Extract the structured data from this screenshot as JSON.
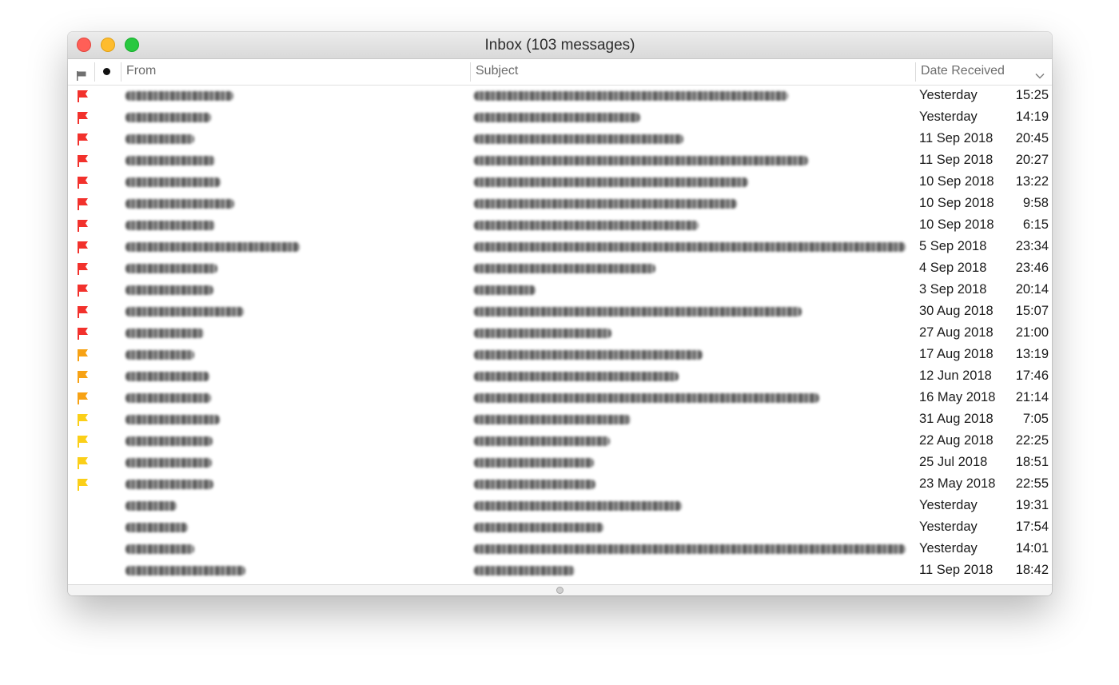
{
  "window": {
    "title": "Inbox (103 messages)"
  },
  "columns": {
    "from": "From",
    "subject": "Subject",
    "date": "Date Received"
  },
  "flag_colors": {
    "red": "#f2312c",
    "orange": "#f7a214",
    "yellow": "#fbcf18"
  },
  "messages": [
    {
      "flag": "red",
      "date": "Yesterday",
      "time": "15:25"
    },
    {
      "flag": "red",
      "date": "Yesterday",
      "time": "14:19"
    },
    {
      "flag": "red",
      "date": "11 Sep 2018",
      "time": "20:45"
    },
    {
      "flag": "red",
      "date": "11 Sep 2018",
      "time": "20:27"
    },
    {
      "flag": "red",
      "date": "10 Sep 2018",
      "time": "13:22"
    },
    {
      "flag": "red",
      "date": "10 Sep 2018",
      "time": "9:58"
    },
    {
      "flag": "red",
      "date": "10 Sep 2018",
      "time": "6:15"
    },
    {
      "flag": "red",
      "date": "5 Sep 2018",
      "time": "23:34"
    },
    {
      "flag": "red",
      "date": "4 Sep 2018",
      "time": "23:46"
    },
    {
      "flag": "red",
      "date": "3 Sep 2018",
      "time": "20:14"
    },
    {
      "flag": "red",
      "date": "30 Aug 2018",
      "time": "15:07"
    },
    {
      "flag": "red",
      "date": "27 Aug 2018",
      "time": "21:00"
    },
    {
      "flag": "orange",
      "date": "17 Aug 2018",
      "time": "13:19"
    },
    {
      "flag": "orange",
      "date": "12 Jun 2018",
      "time": "17:46"
    },
    {
      "flag": "orange",
      "date": "16 May 2018",
      "time": "21:14"
    },
    {
      "flag": "yellow",
      "date": "31 Aug 2018",
      "time": "7:05"
    },
    {
      "flag": "yellow",
      "date": "22 Aug 2018",
      "time": "22:25"
    },
    {
      "flag": "yellow",
      "date": "25 Jul 2018",
      "time": "18:51"
    },
    {
      "flag": "yellow",
      "date": "23 May 2018",
      "time": "22:55"
    },
    {
      "flag": "",
      "date": "Yesterday",
      "time": "19:31"
    },
    {
      "flag": "",
      "date": "Yesterday",
      "time": "17:54"
    },
    {
      "flag": "",
      "date": "Yesterday",
      "time": "14:01"
    },
    {
      "flag": "",
      "date": "11 Sep 2018",
      "time": "18:42"
    }
  ]
}
